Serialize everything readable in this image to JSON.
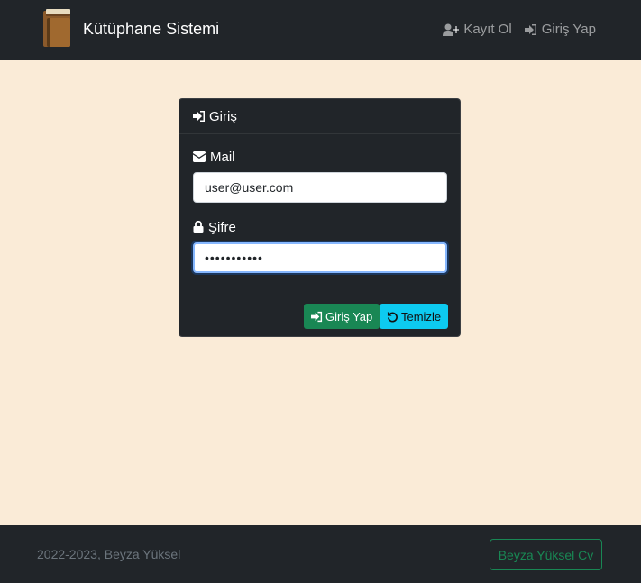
{
  "app": {
    "title": "Kütüphane Sistemi",
    "logo_icon": "book-icon"
  },
  "nav": {
    "register_label": "Kayıt Ol",
    "register_icon": "user-plus-icon",
    "login_label": "Giriş Yap",
    "login_icon": "sign-in-icon"
  },
  "login_card": {
    "header": "Giriş",
    "mail_label": "Mail",
    "mail_value": "user@user.com",
    "password_label": "Şifre",
    "password_value": "•••••••••••",
    "submit_label": "Giriş Yap",
    "clear_label": "Temizle"
  },
  "footer": {
    "copyright": "2022-2023, Beyza Yüksel",
    "cv_label": "Beyza Yüksel Cv"
  },
  "colors": {
    "navbar": "#212529",
    "background": "#faebd7",
    "success": "#198754",
    "info": "#0dcaf0"
  }
}
